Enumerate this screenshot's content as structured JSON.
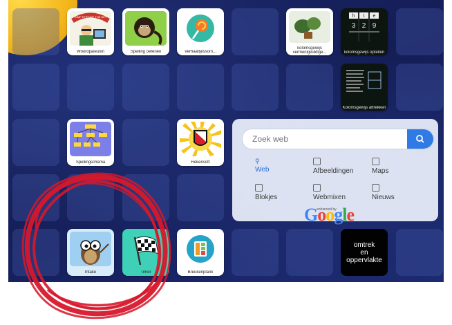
{
  "apps": {
    "woordpaleizen": {
      "label": "Woordpaleizen",
      "banner": "GIMP ETIENNE THE NET"
    },
    "spelling_oefenen": {
      "label": "Spelling oefenen"
    },
    "verhaaltjessom": {
      "label": "Verhaaltjessom..."
    },
    "kolomsgewijs_vermenig": {
      "label": "kolomsgewijs vermenigvuldige..."
    },
    "kolomsgewijs_optellen": {
      "label": "kolomsgewijs optellen",
      "headers": [
        "h",
        "t",
        "e"
      ],
      "digits": [
        "3",
        "2",
        "9"
      ]
    },
    "kolomsgewijs_aftrekken": {
      "label": "Kolomsgewijs aftrekken"
    },
    "spellingschema": {
      "label": "Spellingschema"
    },
    "rekensoft": {
      "label": "Rekensoft"
    },
    "intake": {
      "label": "Intake"
    },
    "timer": {
      "label": "Timer"
    },
    "breukenplank": {
      "label": "Breukenplank"
    }
  },
  "omtrek_tile": {
    "line1": "omtrek",
    "line2": "en",
    "line3": "oppervlakte"
  },
  "search": {
    "placeholder": "Zoek web",
    "links": [
      {
        "label": "Web",
        "icon": "search-icon"
      },
      {
        "label": "Afbeeldingen",
        "icon": "image-icon"
      },
      {
        "label": "Maps",
        "icon": "map-icon"
      },
      {
        "label": "Blokjes",
        "icon": "square-icon"
      },
      {
        "label": "Webmixen",
        "icon": "grid-icon"
      },
      {
        "label": "Nieuws",
        "icon": "news-icon"
      }
    ],
    "google_caption": "enhanced by",
    "google_brand": "Google"
  },
  "colors": {
    "accent": "#2f7ae5",
    "circle": "#d6182b",
    "board": "#1a2566"
  }
}
